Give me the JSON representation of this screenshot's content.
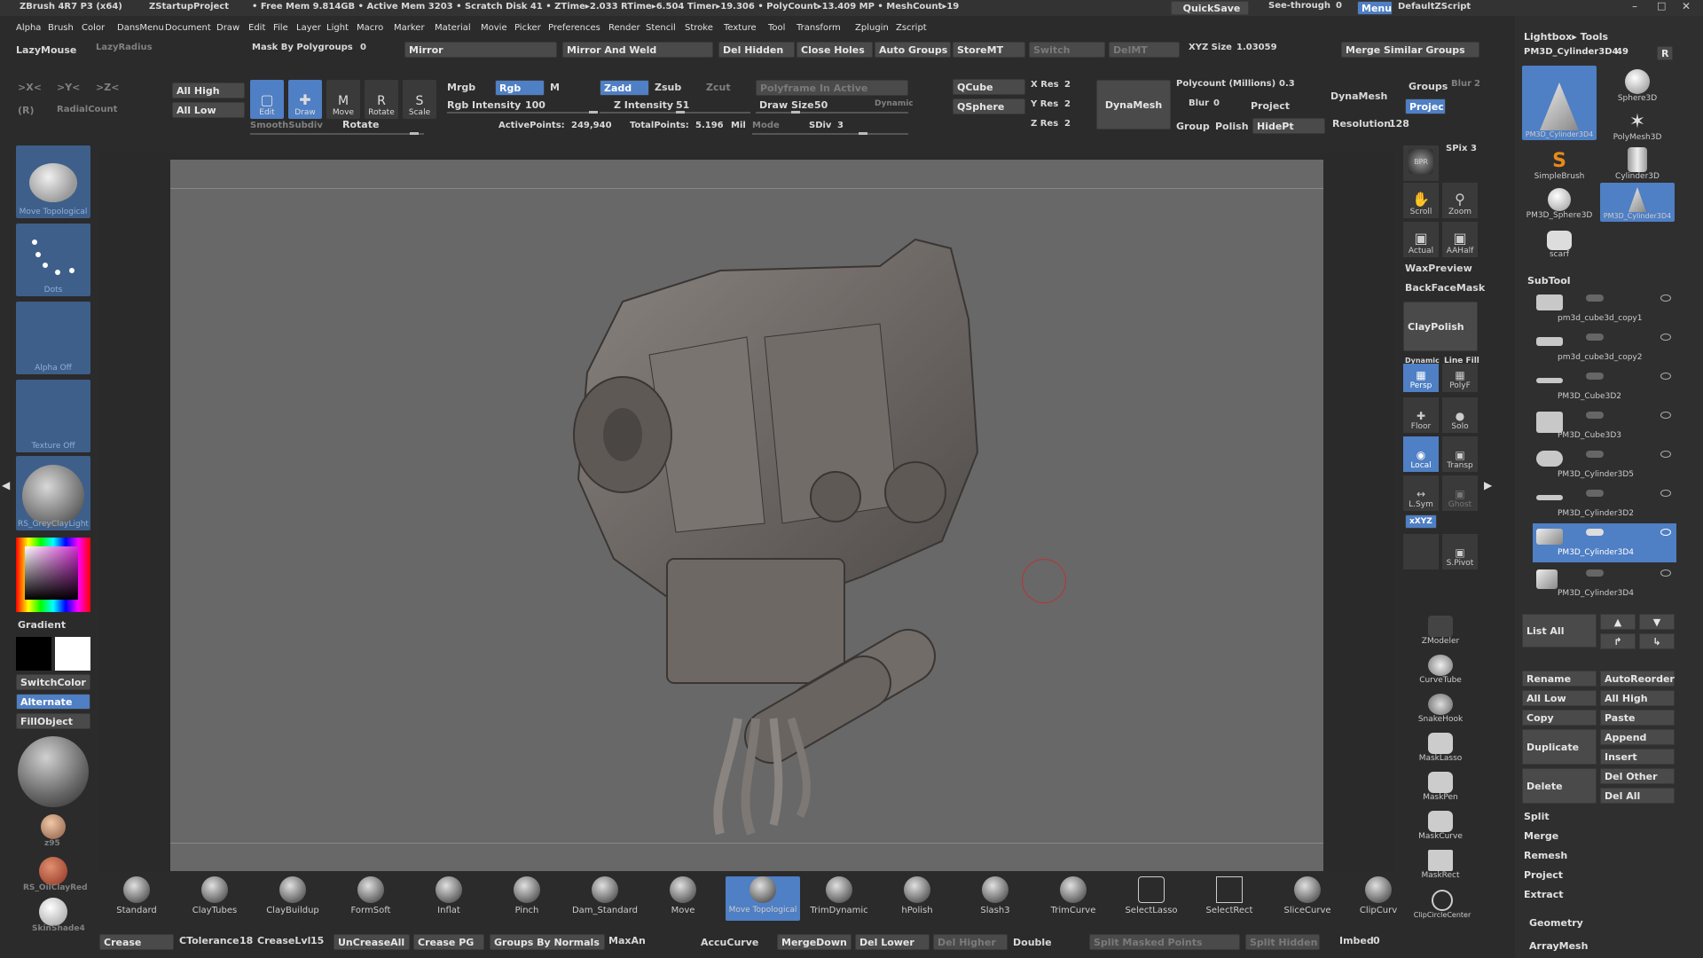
{
  "titlebar": {
    "app": "ZBrush 4R7 P3 (x64)",
    "project": "ZStartupProject",
    "stats": "• Free Mem 9.814GB • Active Mem 3203 • Scratch Disk 41 • ZTime▸2.033 RTime▸6.504 Timer▸19.306 • PolyCount▸13.409 MP • MeshCount▸19",
    "quicksave": "QuickSave",
    "seethrough": "See-through",
    "seethrough_value": "0",
    "menus": "Menus",
    "script": "DefaultZScript"
  },
  "menubar": [
    "Alpha",
    "Brush",
    "Color",
    "DansMenu",
    "Document",
    "Draw",
    "Edit",
    "File",
    "Layer",
    "Light",
    "Macro",
    "Marker",
    "Material",
    "Movie",
    "Picker",
    "Preferences",
    "Render",
    "Stencil",
    "Stroke",
    "Texture",
    "Tool",
    "Transform",
    "Zplugin",
    "Zscript"
  ],
  "toolbar1": {
    "lazymouse": "LazyMouse",
    "lazyradius": "LazyRadius",
    "mask_by_pg": "Mask By Polygroups",
    "mask_by_pg_value": "0",
    "mirror": "Mirror",
    "mirror_weld": "Mirror And Weld",
    "del_hidden": "Del Hidden",
    "close_holes": "Close Holes",
    "auto_groups": "Auto Groups",
    "storemt": "StoreMT",
    "switch": "Switch",
    "delmt": "DelMT",
    "xyz_size": "XYZ Size",
    "xyz_size_value": "1.03059",
    "merge_similar": "Merge Similar Groups"
  },
  "toolbar2": {
    "all_high": "All High",
    "all_low": "All Low",
    "edit": "Edit",
    "draw": "Draw",
    "move": "Move",
    "rotate": "Rotate",
    "scale": "Scale",
    "mrgb": "Mrgb",
    "rgb": "Rgb",
    "m": "M",
    "rgb_intensity": "Rgb Intensity",
    "rgb_intensity_value": "100",
    "zadd": "Zadd",
    "zsub": "Zsub",
    "zcut": "Zcut",
    "z_intensity": "Z Intensity",
    "z_intensity_value": "51",
    "polyframe": "Polyframe In Active",
    "draw_size": "Draw Size",
    "draw_size_value": "50",
    "dynamic": "Dynamic",
    "smoothsubdiv": "SmoothSubdiv",
    "rotate_lbl": "Rotate",
    "active_points": "ActivePoints:",
    "active_points_value": "249,940",
    "total_points": "TotalPoints:",
    "total_points_value": "5.196",
    "total_points_unit": "Mil",
    "mode": "Mode",
    "sdiv": "SDiv",
    "sdiv_value": "3",
    "qcube": "QCube",
    "qsphere": "QSphere",
    "x_res": "X Res",
    "x_res_value": "2",
    "y_res": "Y Res",
    "y_res_value": "2",
    "z_res": "Z Res",
    "z_res_value": "2",
    "dynamesh_btn": "DynaMesh",
    "polycount": "Polycount (Millions)",
    "polycount_value": "0.3",
    "blur": "Blur",
    "blur_value": "0",
    "project": "Project",
    "group": "Group",
    "polish": "Polish",
    "hidept": "HidePt",
    "dynamesh_lbl": "DynaMesh",
    "groups": "Groups",
    "blur2": "Blur",
    "blur2_value": "2",
    "projec": "Projec",
    "resolution": "Resolution",
    "resolution_value": "128",
    "sym_x": ">X<",
    "sym_y": ">Y<",
    "sym_z": ">Z<",
    "r": "(R)",
    "radialcount": "RadialCount"
  },
  "leftshelf": {
    "brush_name": "Move Topological",
    "stroke_name": "Dots",
    "alpha_name": "Alpha Off",
    "texture_name": "Texture Off",
    "material_name": "RS_GreyClayLight",
    "gradient": "Gradient",
    "switchcolor": "SwitchColor",
    "alternate": "Alternate",
    "fillobject": "FillObject",
    "mat2": "z95",
    "mat3": "RS_OilClayRed",
    "mat4": "SkinShade4"
  },
  "viewport_tools": {
    "spix": "SPix",
    "spix_value": "3",
    "bpr": "BPR",
    "scroll": "Scroll",
    "zoom": "Zoom",
    "actual": "Actual",
    "aahalf": "AAHalf",
    "waxpreview": "WaxPreview",
    "backfacemask": "BackFaceMask",
    "claypolish": "ClayPolish",
    "dynamic": "Dynamic",
    "persp": "Persp",
    "line_fill": "Line Fill",
    "polyf": "PolyF",
    "floor": "Floor",
    "solo": "Solo",
    "local": "Local",
    "transp": "Transp",
    "lsym": "L.Sym",
    "ghost": "Ghost",
    "xyz": "xXYZ",
    "spivot": "S.Pivot",
    "zmodeler": "ZModeler",
    "curvetube": "CurveTube",
    "snakehook": "SnakeHook",
    "masklasso": "MaskLasso",
    "maskpen": "MaskPen",
    "maskcurve": "MaskCurve",
    "maskrect": "MaskRect",
    "clipcirclecenter": "ClipCircleCenter"
  },
  "brushes": [
    {
      "name": "Standard"
    },
    {
      "name": "ClayTubes"
    },
    {
      "name": "ClayBuildup"
    },
    {
      "name": "FormSoft"
    },
    {
      "name": "Inflat"
    },
    {
      "name": "Pinch"
    },
    {
      "name": "Dam_Standard"
    },
    {
      "name": "Move"
    },
    {
      "name": "Move Topological"
    },
    {
      "name": "TrimDynamic"
    },
    {
      "name": "hPolish"
    },
    {
      "name": "Slash3"
    },
    {
      "name": "TrimCurve"
    },
    {
      "name": "SelectLasso"
    },
    {
      "name": "SelectRect"
    },
    {
      "name": "SliceCurve"
    },
    {
      "name": "ClipCurv"
    }
  ],
  "bottombar": {
    "crease": "Crease",
    "ctolerance": "CTolerance",
    "ctolerance_value": "18",
    "creaselvl": "CreaseLvl",
    "creaselvl_value": "15",
    "uncreaseall": "UnCreaseAll",
    "crease_pg": "Crease PG",
    "groups_by_normals": "Groups By Normals",
    "maxan": "MaxAn",
    "accucurve": "AccuCurve",
    "mergedown": "MergeDown",
    "del_lower": "Del Lower",
    "del_higher": "Del Higher",
    "double": "Double",
    "split_masked": "Split Masked Points",
    "split_hidden": "Split Hidden",
    "imbed": "Imbed",
    "imbed_value": "0"
  },
  "rightpanel": {
    "lightbox_tools": "Lightbox▸ Tools",
    "current_tool": "PM3D_Cylinder3D4.",
    "current_tool_value": "49",
    "r_btn": "R",
    "lightbox_items": [
      {
        "name": "PM3D_Cylinder3D4"
      },
      {
        "name": "Sphere3D"
      },
      {
        "name": "SimpleBrush"
      },
      {
        "name": "PolyMesh3D"
      },
      {
        "name": "PM3D_Sphere3D"
      },
      {
        "name": "Cylinder3D"
      },
      {
        "name": "scarf"
      },
      {
        "name": "PM3D_Cylinder3D4"
      }
    ],
    "subtool": "SubTool",
    "subtools": [
      {
        "name": "pm3d_cube3d_copy1"
      },
      {
        "name": "pm3d_cube3d_copy2"
      },
      {
        "name": "PM3D_Cube3D2"
      },
      {
        "name": "PM3D_Cube3D3"
      },
      {
        "name": "PM3D_Cylinder3D5"
      },
      {
        "name": "PM3D_Cylinder3D2"
      },
      {
        "name": "PM3D_Cylinder3D4"
      },
      {
        "name": "PM3D_Cylinder3D4"
      }
    ],
    "list_all": "List All",
    "rename": "Rename",
    "autoreorder": "AutoReorder",
    "all_low": "All Low",
    "all_high": "All High",
    "copy": "Copy",
    "paste": "Paste",
    "duplicate": "Duplicate",
    "append": "Append",
    "insert": "Insert",
    "delete": "Delete",
    "del_other": "Del Other",
    "del_all": "Del All",
    "split": "Split",
    "merge": "Merge",
    "remesh": "Remesh",
    "project": "Project",
    "extract": "Extract",
    "geometry": "Geometry",
    "arraymesh": "ArrayMesh"
  }
}
